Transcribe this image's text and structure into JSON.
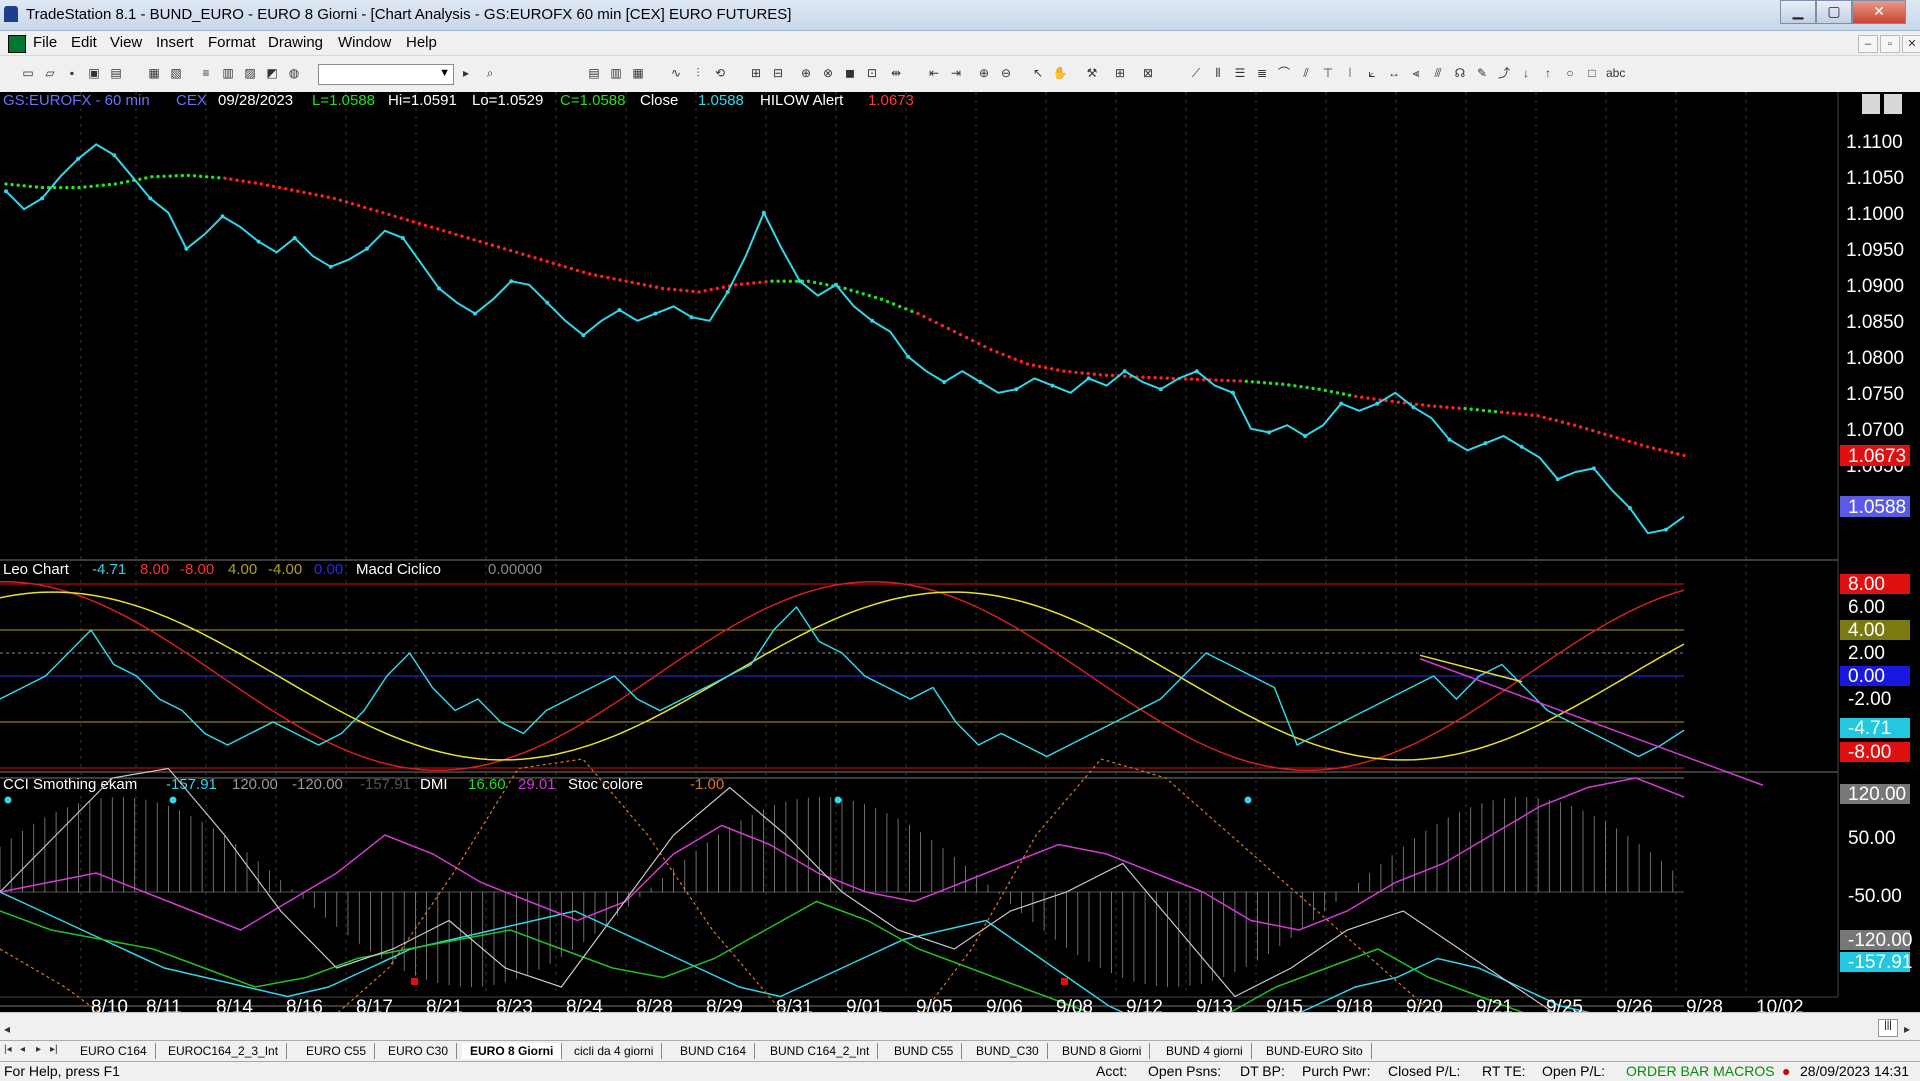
{
  "window": {
    "title": "TradeStation 8.1 - BUND_EURO - EURO 8 Giorni - [Chart Analysis - GS:EUROFX  60 min  [CEX] EURO FUTURES]",
    "min_glyph": "▁",
    "max_glyph": "▢",
    "close_glyph": "✕"
  },
  "menu": {
    "items": [
      "File",
      "Edit",
      "View",
      "Insert",
      "Format",
      "Drawing",
      "Window",
      "Help"
    ]
  },
  "chart": {
    "header": {
      "symbol": "GS:EUROFX - 60 min",
      "exchange": "CEX",
      "date": "09/28/2023",
      "last": "L=1.0588",
      "high": "Hi=1.0591",
      "low": "Lo=1.0529",
      "close_val": "C=1.0588",
      "close_label": "Close",
      "close_price": "1.0588",
      "alert_label": "HILOW Alert",
      "alert_price": "1.0673"
    },
    "price_scale": [
      "1.1100",
      "1.1050",
      "1.1000",
      "1.0950",
      "1.0900",
      "1.0850",
      "1.0800",
      "1.0750",
      "1.0700",
      "1.0650"
    ],
    "price_markers": {
      "red": "1.0673",
      "blue": "1.0588"
    },
    "osc_header": {
      "name": "Leo Chart",
      "v1": "-4.71",
      "v2": "8.00",
      "v3": "-8.00",
      "v4": "4.00",
      "v5": "-4.00",
      "v6": "0.00",
      "name2": "Macd Ciclico",
      "v7": "0.00000"
    },
    "osc_scale": [
      "8.00",
      "6.00",
      "4.00",
      "2.00",
      "0.00",
      "-2.00",
      "-4.71",
      "-8.00"
    ],
    "cci_header": {
      "name": "CCI Smothing ekam",
      "v1": "-157.91",
      "v2": "120.00",
      "v3": "-120.00",
      "v4": "-157.91",
      "name2": "DMI",
      "v5": "16.60",
      "v6": "29.01",
      "name3": "Stoc colore",
      "v7": "-1.00"
    },
    "cci_scale": [
      "120.00",
      "50.00",
      "-50.00",
      "-120.00",
      "-157.91"
    ],
    "dates": [
      "8/10",
      "8/11",
      "8/14",
      "8/16",
      "8/17",
      "8/21",
      "8/23",
      "8/24",
      "8/28",
      "8/29",
      "8/31",
      "9/01",
      "9/05",
      "9/06",
      "9/08",
      "9/12",
      "9/13",
      "9/15",
      "9/18",
      "9/20",
      "9/21",
      "9/25",
      "9/26",
      "9/28",
      "10/02"
    ],
    "colors": {
      "price": "#33d6e8",
      "avg_above": "#ff2020",
      "avg_below": "#22e022",
      "yellow": "#e6e12a",
      "magenta": "#d43ad4",
      "orange": "#d87a20"
    }
  },
  "tabs": [
    "EURO C164",
    "EUROC164_2_3_Int",
    "EURO C55",
    "EURO C30",
    "EURO 8 Giorni",
    "cicli da 4 giorni",
    "BUND C164",
    "BUND C164_2_Int",
    "BUND C55",
    "BUND_C30",
    "BUND 8 Giorni",
    "BUND 4 giorni",
    "BUND-EURO Sito"
  ],
  "active_tab": "EURO 8 Giorni",
  "status": {
    "help": "For Help, press F1",
    "acct": "Acct:",
    "open_psns": "Open Psns:",
    "dt_bp": "DT BP:",
    "purch_pwr": "Purch Pwr:",
    "closed_pl": "Closed P/L:",
    "rt_te": "RT TE:",
    "open_pl": "Open P/L:",
    "macros": "ORDER BAR  MACROS",
    "datetime": "28/09/2023 14:31"
  }
}
